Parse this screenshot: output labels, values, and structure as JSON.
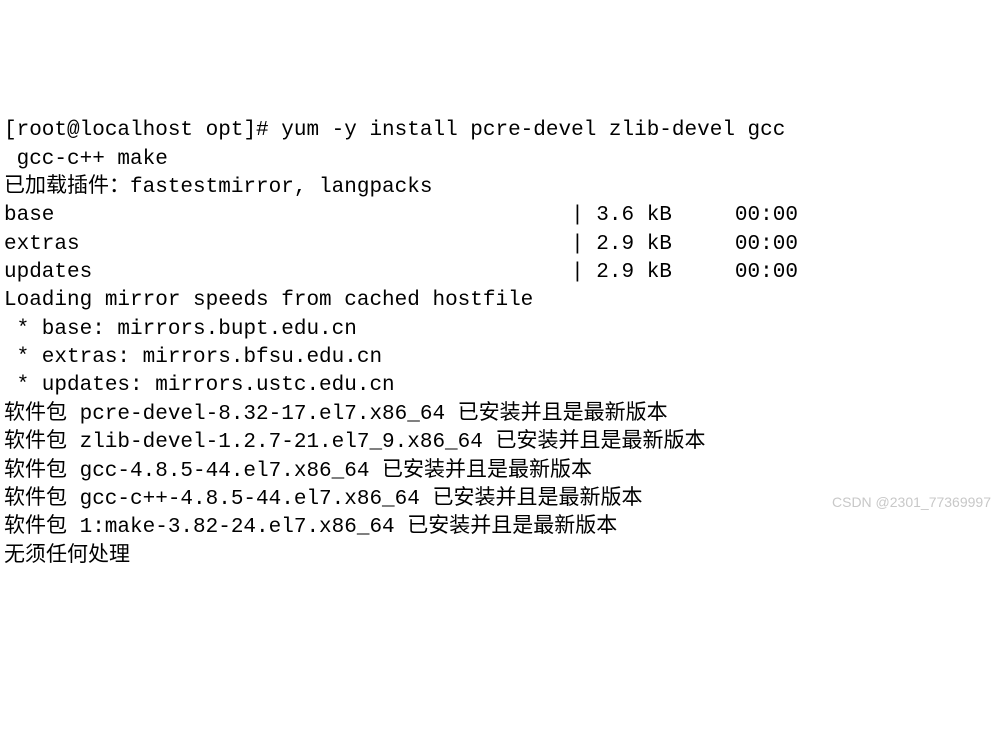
{
  "prompt": {
    "user": "root",
    "host": "localhost",
    "dir": "opt",
    "symbol": "#",
    "command": "yum -y install pcre-devel zlib-devel gcc gcc-c++ make"
  },
  "plugins_line": "已加载插件：fastestmirror, langpacks",
  "repos": [
    {
      "name": "base",
      "size": "3.6 kB",
      "time": "00:00"
    },
    {
      "name": "extras",
      "size": "2.9 kB",
      "time": "00:00"
    },
    {
      "name": "updates",
      "size": "2.9 kB",
      "time": "00:00"
    }
  ],
  "loading_line": "Loading mirror speeds from cached hostfile",
  "mirrors": [
    {
      "label": "base",
      "host": "mirrors.bupt.edu.cn"
    },
    {
      "label": "extras",
      "host": "mirrors.bfsu.edu.cn"
    },
    {
      "label": "updates",
      "host": "mirrors.ustc.edu.cn"
    }
  ],
  "pkg_prefix": "软件包 ",
  "pkg_suffix": " 已安装并且是最新版本",
  "packages": [
    "pcre-devel-8.32-17.el7.x86_64",
    "zlib-devel-1.2.7-21.el7_9.x86_64",
    "gcc-4.8.5-44.el7.x86_64",
    "gcc-c++-4.8.5-44.el7.x86_64",
    "1:make-3.82-24.el7.x86_64"
  ],
  "final_line": "无须任何处理",
  "watermark": "CSDN @2301_77369997"
}
